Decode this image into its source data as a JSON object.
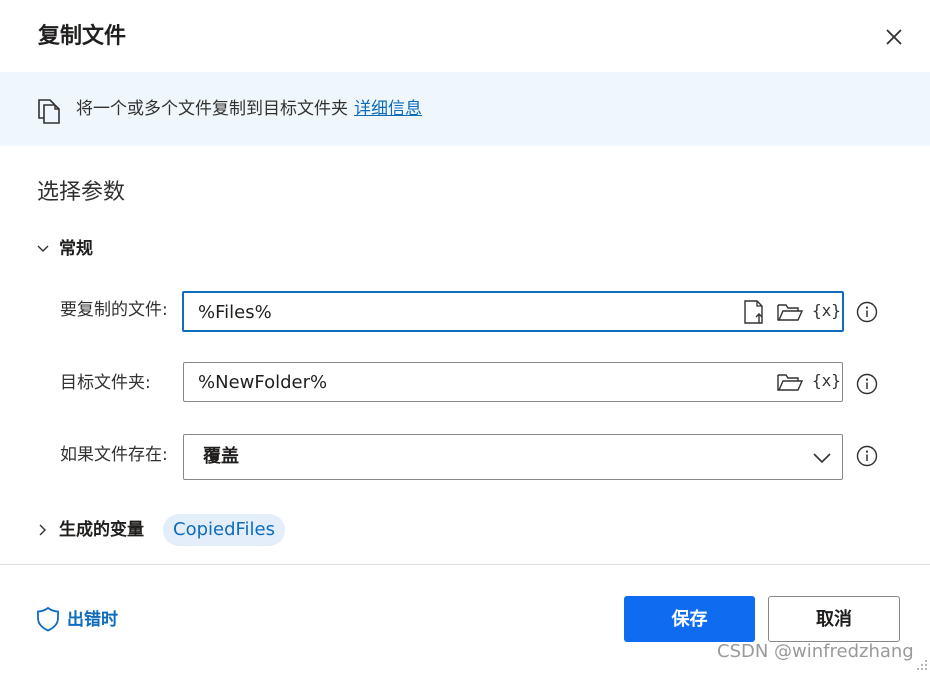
{
  "dialog": {
    "title": "复制文件",
    "close_icon": "close-icon"
  },
  "banner": {
    "icon": "copy-file-icon",
    "text": "将一个或多个文件复制到目标文件夹",
    "link": "详细信息"
  },
  "section": {
    "title": "选择参数"
  },
  "group_general": {
    "label": "常规",
    "expanded": true
  },
  "fields": {
    "files_to_copy": {
      "label": "要复制的文件:",
      "value": "%Files%",
      "icons": [
        "select-file-icon",
        "folder-icon",
        "variable-icon"
      ]
    },
    "destination_folder": {
      "label": "目标文件夹:",
      "value": "%NewFolder%",
      "icons": [
        "folder-icon",
        "variable-icon"
      ]
    },
    "if_file_exists": {
      "label": "如果文件存在:",
      "value": "覆盖"
    }
  },
  "variables": {
    "label": "生成的变量",
    "expanded": false,
    "items": [
      "CopiedFiles"
    ]
  },
  "footer": {
    "on_error": "出错时",
    "save": "保存",
    "cancel": "取消"
  },
  "watermark": "CSDN @winfredzhang",
  "colors": {
    "accent": "#0f6cbd",
    "primary_button": "#0f6cf0",
    "banner_bg": "#eff6fc",
    "pill_bg": "#e3eefa"
  }
}
